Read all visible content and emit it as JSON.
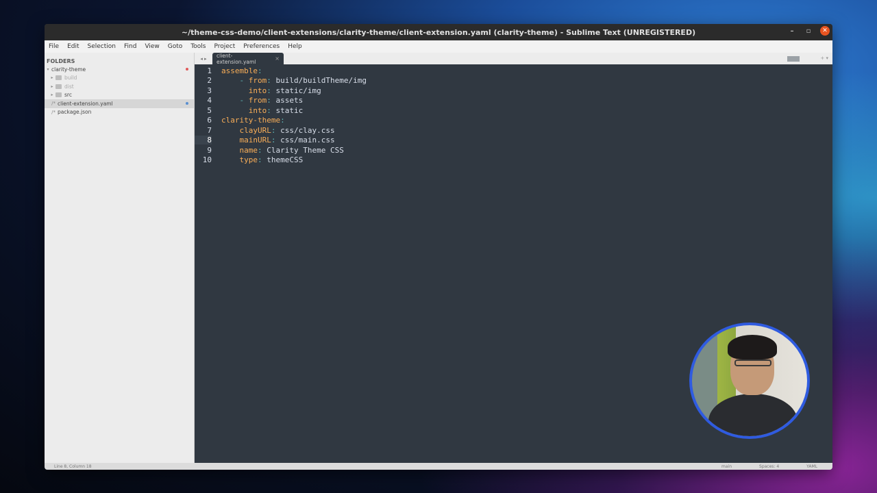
{
  "window": {
    "title": "~/theme-css-demo/client-extensions/clarity-theme/client-extension.yaml (clarity-theme) - Sublime Text (UNREGISTERED)",
    "minimize": "–",
    "maximize": "▫",
    "close": "✕"
  },
  "menu": [
    "File",
    "Edit",
    "Selection",
    "Find",
    "View",
    "Goto",
    "Tools",
    "Project",
    "Preferences",
    "Help"
  ],
  "sidebar": {
    "title": "FOLDERS",
    "root": "clarity-theme",
    "folders": [
      "build",
      "dist",
      "src"
    ],
    "files": [
      "client-extension.yaml",
      "package.json"
    ]
  },
  "tab": {
    "arrows": "◂ ▸",
    "label": "client-extension.yaml",
    "close": "×",
    "right": "+ ▾"
  },
  "code": {
    "current_line": 8,
    "lines": [
      {
        "n": "1",
        "indent": "",
        "dash": "",
        "key": "assemble",
        "value": ""
      },
      {
        "n": "2",
        "indent": "    ",
        "dash": "- ",
        "key": "from",
        "value": "build/buildTheme/img"
      },
      {
        "n": "3",
        "indent": "      ",
        "dash": "",
        "key": "into",
        "value": "static/img"
      },
      {
        "n": "4",
        "indent": "    ",
        "dash": "- ",
        "key": "from",
        "value": "assets"
      },
      {
        "n": "5",
        "indent": "      ",
        "dash": "",
        "key": "into",
        "value": "static"
      },
      {
        "n": "6",
        "indent": "",
        "dash": "",
        "key": "clarity-theme",
        "value": ""
      },
      {
        "n": "7",
        "indent": "    ",
        "dash": "",
        "key": "clayURL",
        "value": "css/clay.css"
      },
      {
        "n": "8",
        "indent": "    ",
        "dash": "",
        "key": "mainURL",
        "value": "css/main.css"
      },
      {
        "n": "9",
        "indent": "    ",
        "dash": "",
        "key": "name",
        "value": "Clarity Theme CSS"
      },
      {
        "n": "10",
        "indent": "    ",
        "dash": "",
        "key": "type",
        "value": "themeCSS"
      }
    ]
  },
  "status": {
    "position": "Line 8, Column 18",
    "branch": "main",
    "spaces": "Spaces: 4",
    "syntax": "YAML"
  },
  "colors": {
    "editor_bg": "#303841",
    "key": "#f9ae58",
    "punct": "#5fb4b4",
    "text": "#d8dee9",
    "modified_dot": "#e05a5a",
    "file_dot": "#5a8fd0",
    "webcam_ring": "#2f5be0"
  }
}
